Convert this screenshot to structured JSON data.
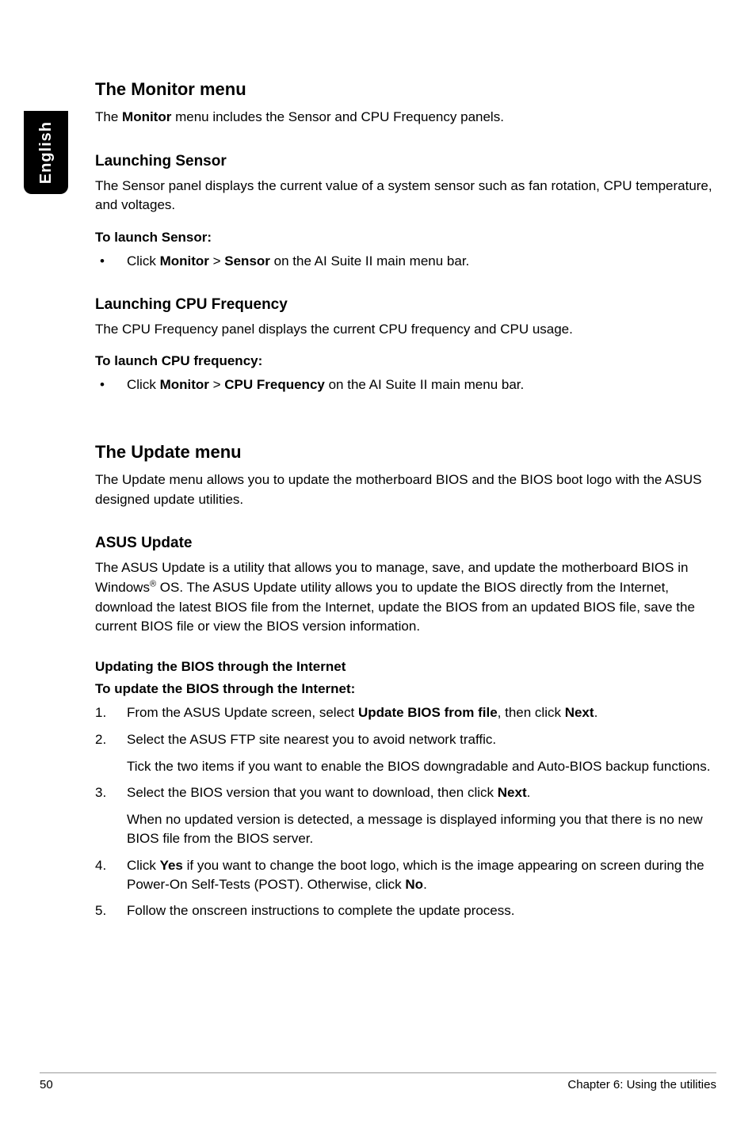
{
  "sideTab": "English",
  "monitor": {
    "heading": "The Monitor menu",
    "intro_pre": "The ",
    "intro_bold": "Monitor",
    "intro_post": " menu includes the Sensor and CPU Frequency panels.",
    "sensor": {
      "heading": "Launching Sensor",
      "body": "The Sensor panel displays the current value of a system sensor such as fan rotation, CPU temperature, and voltages.",
      "toLaunch": "To launch Sensor:",
      "step_pre": "Click ",
      "step_b1": "Monitor",
      "step_mid": " > ",
      "step_b2": "Sensor",
      "step_post": " on the AI Suite II main menu bar."
    },
    "cpu": {
      "heading": "Launching CPU Frequency",
      "body": "The CPU Frequency panel displays the current CPU frequency and CPU usage.",
      "toLaunch": "To launch CPU frequency:",
      "step_pre": "Click ",
      "step_b1": "Monitor",
      "step_mid": " > ",
      "step_b2": "CPU Frequency",
      "step_post": " on the AI Suite II main menu bar."
    }
  },
  "update": {
    "heading": "The Update menu",
    "intro": "The Update menu allows you to update the motherboard BIOS and the BIOS boot logo with the ASUS designed update utilities.",
    "asus": {
      "heading": "ASUS Update",
      "body_pre": "The ASUS Update is a utility that allows you to manage, save, and update the motherboard BIOS in Windows",
      "body_sup": "®",
      "body_post": " OS. The ASUS Update utility allows you to update the BIOS directly from the Internet, download the latest BIOS file from the Internet, update the BIOS from an updated BIOS file, save the current BIOS file or view the BIOS version information.",
      "h4a": "Updating the BIOS through the Internet",
      "h4b": "To update the BIOS through the Internet:",
      "steps": {
        "s1_pre": "From the ASUS Update screen, select ",
        "s1_b1": "Update BIOS from file",
        "s1_mid": ", then click ",
        "s1_b2": "Next",
        "s1_post": ".",
        "s2_main": "Select the ASUS FTP site nearest you to avoid network traffic.",
        "s2_sub": "Tick the two items if you want to enable the BIOS downgradable and Auto-BIOS backup functions.",
        "s3_pre": "Select the BIOS version that you want to download, then click ",
        "s3_b": "Next",
        "s3_post": ".",
        "s3_sub": "When no updated version is detected, a message is displayed informing you that there is no new BIOS file from the BIOS server.",
        "s4_pre": "Click ",
        "s4_b1": "Yes",
        "s4_mid": " if you want to change the boot logo, which is the image appearing on screen during the Power-On Self-Tests (POST). Otherwise, click ",
        "s4_b2": "No",
        "s4_post": ".",
        "s5": "Follow the onscreen instructions to complete the update process."
      }
    }
  },
  "footer": {
    "page": "50",
    "chapter": "Chapter 6: Using the utilities"
  }
}
